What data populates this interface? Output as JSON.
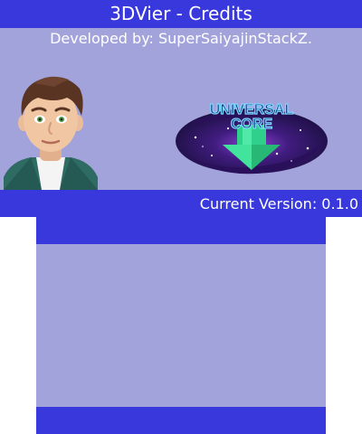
{
  "window": {
    "title": "3DVier - Credits"
  },
  "credits": {
    "developer_line": "Developed by: SuperSaiyajinStackZ.",
    "logo_text_top": "UNIVERSAL",
    "logo_text_bottom": "CORE"
  },
  "status": {
    "version_line": "Current Version: 0.1.0"
  },
  "colors": {
    "bar": "#3838dc",
    "panel": "#a3a3dc",
    "text": "#ffffff"
  }
}
